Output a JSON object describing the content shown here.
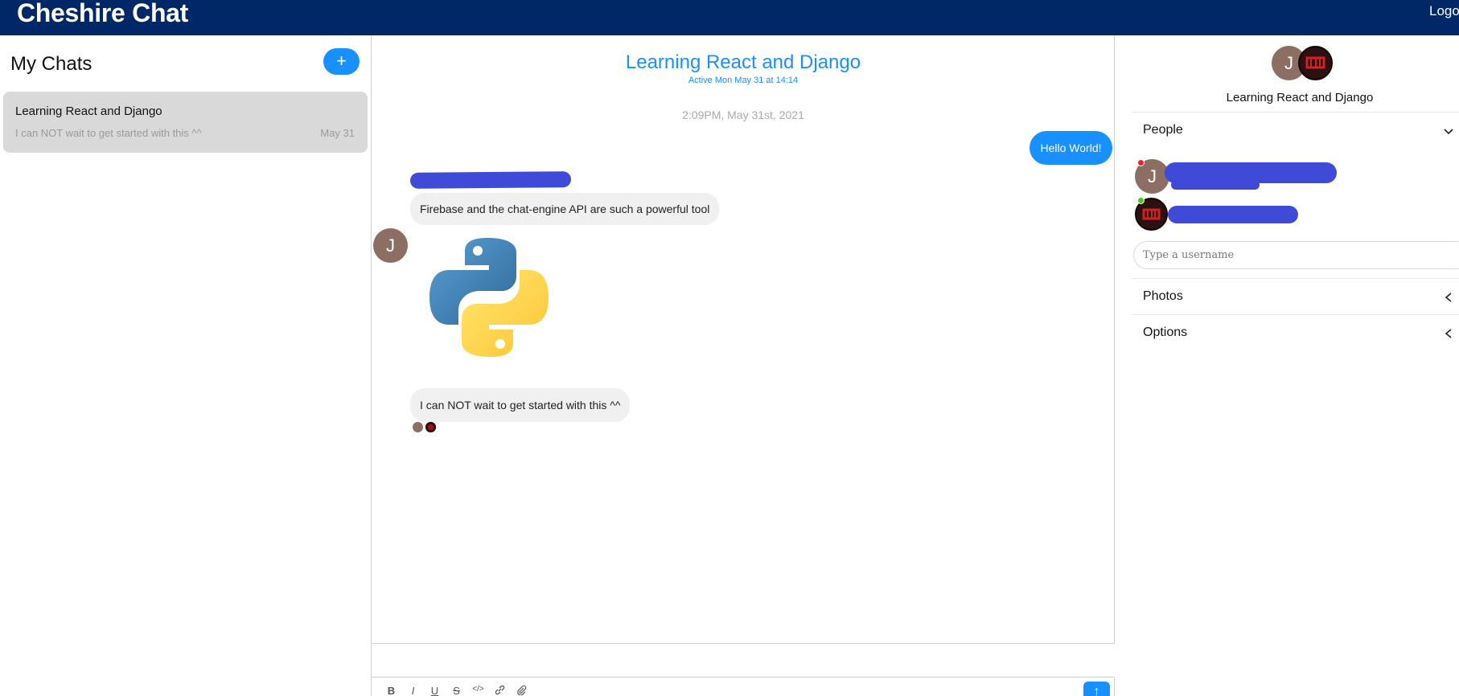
{
  "header": {
    "brand": "Cheshire Chat",
    "logout_label": "Logout"
  },
  "left_panel": {
    "title": "My Chats",
    "new_chat_icon": "+",
    "chats": [
      {
        "title": "Learning React and Django",
        "preview": "I can NOT wait to get started with this ^^",
        "date": "May 31"
      }
    ]
  },
  "conversation": {
    "title": "Learning React and Django",
    "active_text": "Active Mon May 31 at 14:14",
    "timestamp": "2:09PM, May 31st, 2021",
    "messages": [
      {
        "direction": "outgoing",
        "text": "Hello World!"
      },
      {
        "direction": "incoming",
        "text": "Firebase and the chat-engine API are such a powerful tool"
      },
      {
        "direction": "incoming",
        "type": "image",
        "image": "python-logo"
      },
      {
        "direction": "incoming",
        "text": "I can NOT wait to get started with this ^^"
      }
    ],
    "avatar_initial": "J",
    "format_tools": [
      "B",
      "I",
      "U",
      "S",
      "</>",
      "link",
      "attach"
    ],
    "send_icon": "↑"
  },
  "settings": {
    "group_title": "Learning React and Django",
    "avatar_initial": "J",
    "people_label": "People",
    "username_placeholder": "Type a username",
    "photos_label": "Photos",
    "options_label": "Options",
    "colors": {
      "online": "#52c41a",
      "offline": "#f5222d",
      "accent": "#1890ff",
      "header": "#002766"
    }
  }
}
